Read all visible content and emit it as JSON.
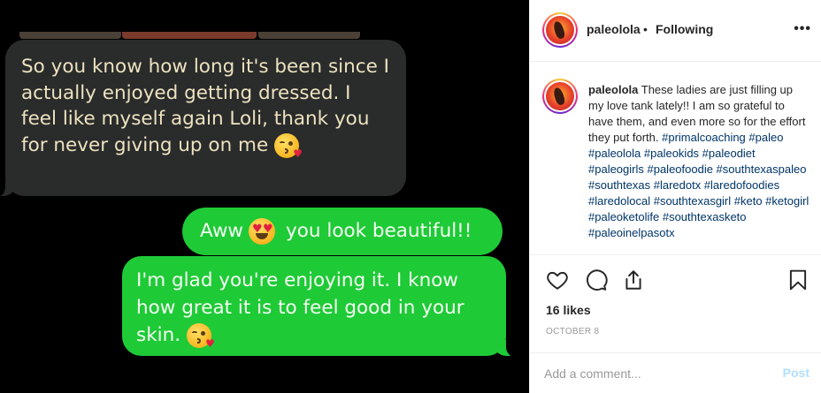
{
  "media": {
    "incoming_message": "So you know how long it's been since I actually enjoyed getting dressed. I feel like myself again Loli, thank you for never giving up on me",
    "outgoing_message_1_before": "Aww",
    "outgoing_message_1_after": "you look beautiful!!",
    "outgoing_message_2": "I'm glad you're enjoying it. I know how great it is to feel good in your skin.",
    "emojis": [
      "face-blowing-kiss",
      "smiling-face-with-heart-eyes",
      "face-blowing-kiss"
    ],
    "colors": {
      "incoming_bubble": "#2a2b2b",
      "incoming_text": "#ece2c0",
      "outgoing_bubble": "#1fca37",
      "background": "#000000"
    }
  },
  "header": {
    "username": "paleolola",
    "separator": "•",
    "follow_status": "Following",
    "more_icon": "more-horizontal-icon"
  },
  "caption": {
    "username": "paleolola",
    "text": "These ladies are just filling up my love tank lately!! I am so grateful to have them, and even more so for the effort they put forth.",
    "hashtags": "#primalcoaching #paleo #paleolola #paleokids #paleodiet #paleogirls #paleofoodie #southtexaspaleo #southtexas #laredotx #laredofoodies #laredolocal #southtexasgirl #keto #ketogirl #paleoketolife #southtexasketo #paleoinelpasotx"
  },
  "actions": {
    "icons": [
      "heart-icon",
      "comment-icon",
      "share-icon",
      "bookmark-icon"
    ],
    "likes": "16 likes",
    "date": "OCTOBER 8"
  },
  "comment_box": {
    "placeholder": "Add a comment...",
    "post_label": "Post"
  },
  "colors": {
    "link": "#003569",
    "post_button_disabled": "#b2dffc",
    "meta_text": "#999999"
  }
}
